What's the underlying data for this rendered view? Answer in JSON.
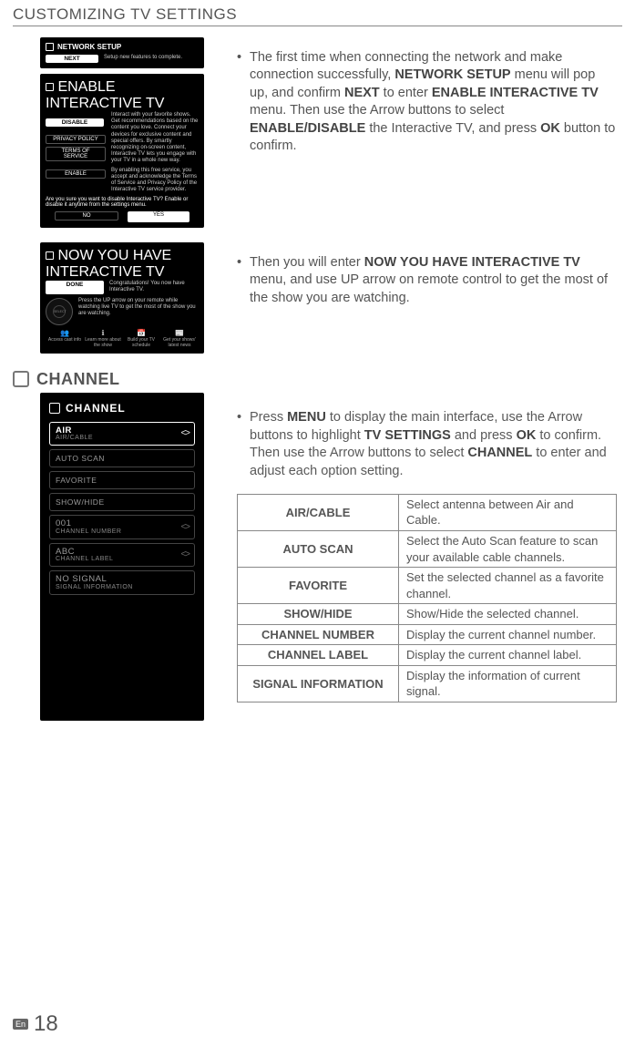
{
  "header": {
    "title": "CUSTOMIZING TV SETTINGS"
  },
  "section1": {
    "bullet": "•",
    "text_pre": "The first time when connecting the network and make connection successfully, ",
    "b1": "NETWORK SETUP",
    "t2": " menu will pop up, and confirm ",
    "b2": "NEXT",
    "t3": " to enter ",
    "b3": "ENABLE INTERACTIVE TV",
    "t4": " menu. Then use the Arrow buttons to select ",
    "b4": "ENABLE/DISABLE",
    "t5": " the Interactive TV, and press ",
    "b5": "OK",
    "t6": " button to confirm."
  },
  "tv1": {
    "title": "NETWORK SETUP",
    "btn": "NEXT",
    "desc": "Setup new features to complete."
  },
  "tv2": {
    "title": "ENABLE INTERACTIVE TV",
    "disable": "DISABLE",
    "privacy": "PRIVACY POLICY",
    "terms": "TERMS OF SERVICE",
    "enable": "ENABLE",
    "desc1": "Interact with your favorite shows. Get recommendations based on the content you love. Connect your devices for exclusive content and special offers. By smartly recognizing on-screen content, Interactive TV lets you engage with your TV in a whole new way.",
    "desc2": "By enabling this free service, you accept and acknowledge the Terms of Service and Privacy Policy of the Interactive TV service provider.",
    "confirm": "Are you sure you want to disable Interactive TV? Enable or disable it anytime from the settings menu.",
    "no": "NO",
    "yes": "YES"
  },
  "section2": {
    "bullet": "•",
    "t1": "Then you will enter ",
    "b1": "NOW YOU HAVE INTERACTIVE TV",
    "t2": " menu, and use UP arrow on remote control to get the most of the show you are watching."
  },
  "tv3": {
    "title": "NOW YOU HAVE INTERACTIVE TV",
    "done": "DONE",
    "desc1": "Congratulations! You now have Interactive TV.",
    "desc2": "Press the UP arrow on your remote while watching live TV to get the most of the show you are watching.",
    "icons": {
      "a": "Access cast info",
      "b": "Learn more about the show",
      "c": "Build your TV schedule",
      "d": "Get your shows' latest news"
    }
  },
  "channel_heading": "CHANNEL",
  "section3": {
    "bullet": "•",
    "t1": "Press ",
    "b1": "MENU",
    "t2": " to display the main interface, use the Arrow buttons to highlight ",
    "b2": "TV SETTINGS",
    "t3": " and press ",
    "b3": "OK",
    "t4": " to confirm. Then use the Arrow buttons to select ",
    "b4": "CHANNEL",
    "t5": " to enter and adjust each option setting."
  },
  "channel_panel": {
    "title": "CHANNEL",
    "items": {
      "air_main": "AIR",
      "air_sub": "AIR/CABLE",
      "auto": "AUTO SCAN",
      "fav": "FAVORITE",
      "sh": "SHOW/HIDE",
      "num_main": "001",
      "num_sub": "CHANNEL NUMBER",
      "lab_main": "ABC",
      "lab_sub": "CHANNEL LABEL",
      "sig_main": "NO SIGNAL",
      "sig_sub": "SIGNAL INFORMATION"
    }
  },
  "table": {
    "rows": [
      {
        "k": "AIR/CABLE",
        "v": "Select antenna between Air and Cable."
      },
      {
        "k": "AUTO SCAN",
        "v": "Select the Auto Scan feature to scan your available cable channels."
      },
      {
        "k": "FAVORITE",
        "v": "Set the selected channel as a favorite channel."
      },
      {
        "k": "SHOW/HIDE",
        "v": "Show/Hide the selected channel."
      },
      {
        "k": "CHANNEL NUMBER",
        "v": "Display the current channel number."
      },
      {
        "k": "CHANNEL LABEL",
        "v": "Display the current channel label."
      },
      {
        "k": "SIGNAL INFORMATION",
        "v": "Display the information of current signal."
      }
    ]
  },
  "footer": {
    "lang": "En",
    "page": "18"
  }
}
